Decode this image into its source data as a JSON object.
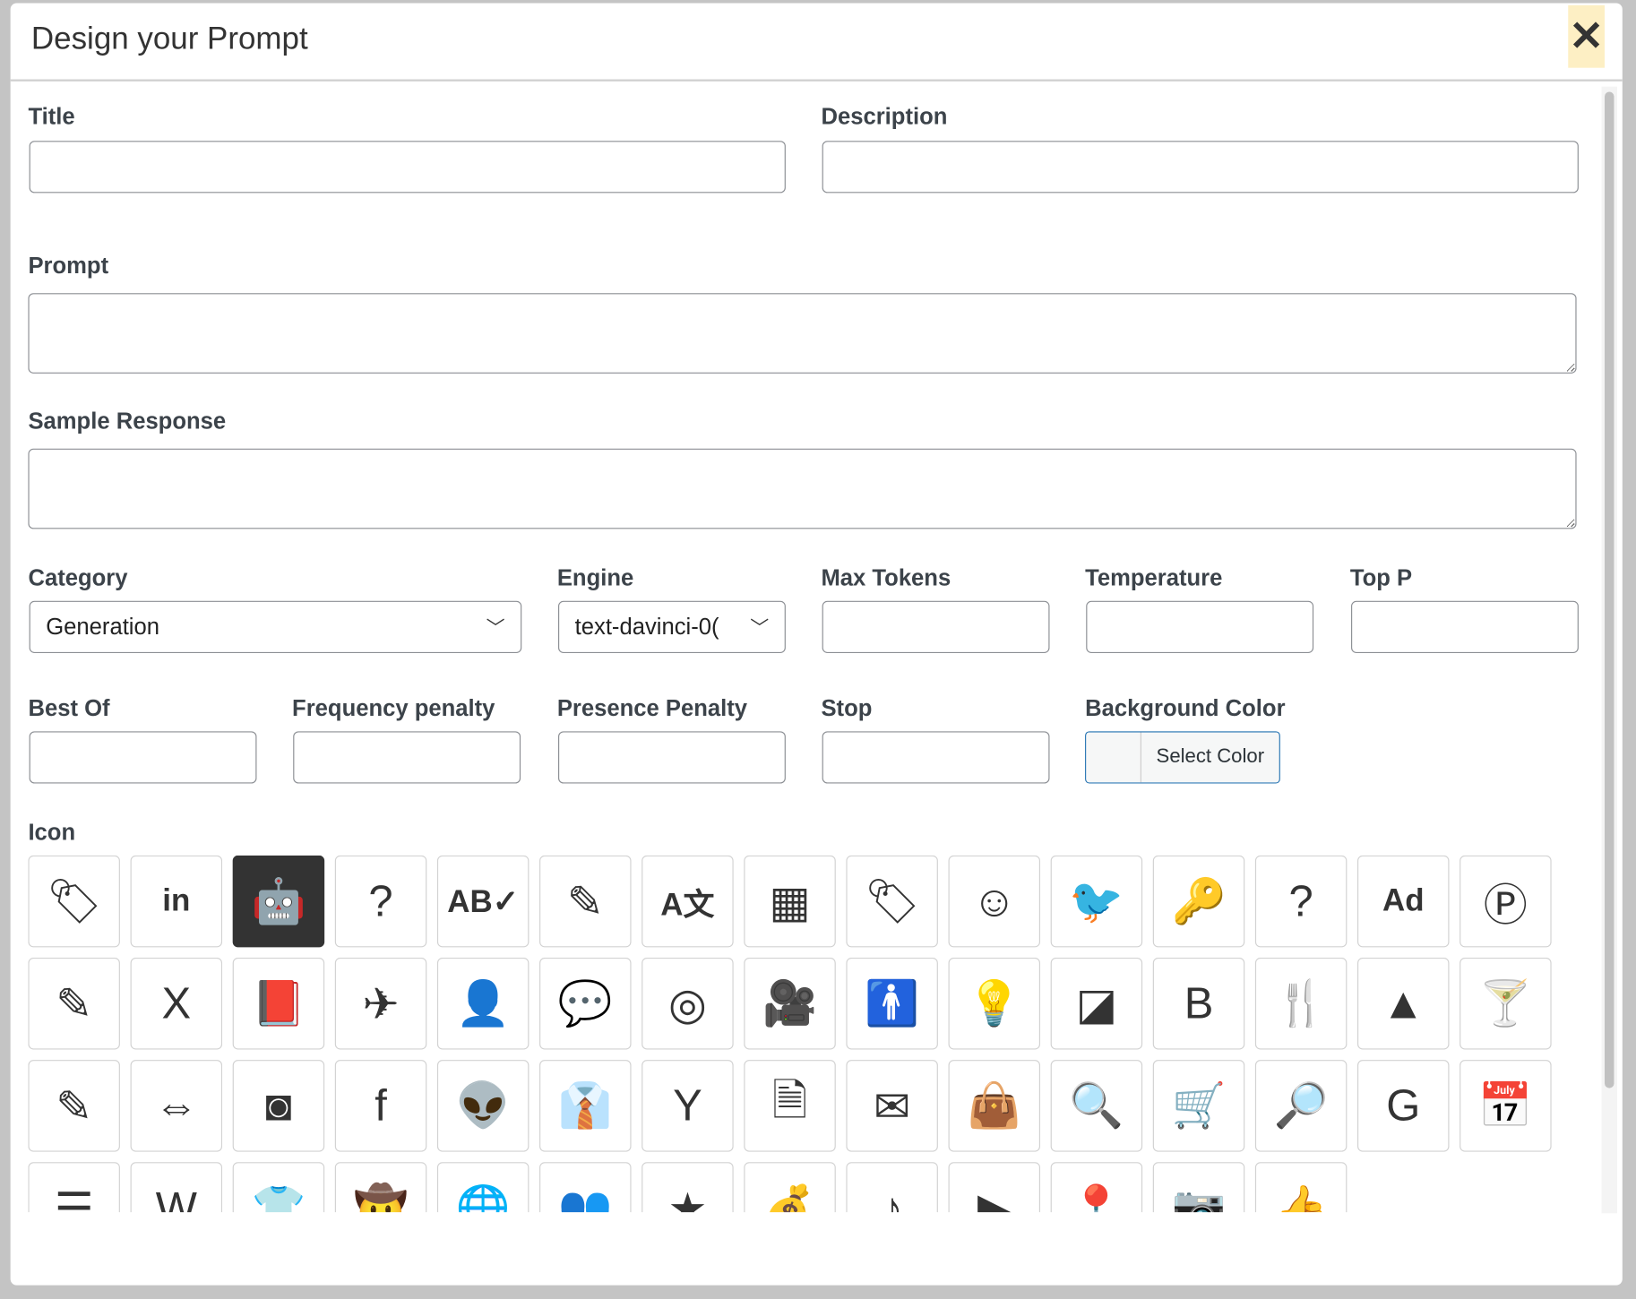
{
  "modal": {
    "title": "Design your Prompt",
    "close_label": "✕"
  },
  "fields": {
    "title": {
      "label": "Title",
      "value": ""
    },
    "description": {
      "label": "Description",
      "value": ""
    },
    "prompt": {
      "label": "Prompt",
      "value": ""
    },
    "sample_response": {
      "label": "Sample Response",
      "value": ""
    },
    "category": {
      "label": "Category",
      "value": "Generation"
    },
    "engine": {
      "label": "Engine",
      "value": "text-davinci-0("
    },
    "max_tokens": {
      "label": "Max Tokens",
      "value": ""
    },
    "temperature": {
      "label": "Temperature",
      "value": ""
    },
    "top_p": {
      "label": "Top P",
      "value": ""
    },
    "best_of": {
      "label": "Best Of",
      "value": ""
    },
    "frequency_penalty": {
      "label": "Frequency penalty",
      "value": ""
    },
    "presence_penalty": {
      "label": "Presence Penalty",
      "value": ""
    },
    "stop": {
      "label": "Stop",
      "value": ""
    },
    "background_color": {
      "label": "Background Color",
      "button_label": "Select Color"
    }
  },
  "icons": {
    "label": "Icon",
    "selected": "robot",
    "items": [
      {
        "name": "tag",
        "glyph": "🏷"
      },
      {
        "name": "linkedin",
        "glyph": "in"
      },
      {
        "name": "robot",
        "glyph": "🤖"
      },
      {
        "name": "question-circle",
        "glyph": "?"
      },
      {
        "name": "spell-check",
        "glyph": "AB✓"
      },
      {
        "name": "edit",
        "glyph": "✎"
      },
      {
        "name": "language",
        "glyph": "A文"
      },
      {
        "name": "table",
        "glyph": "▦"
      },
      {
        "name": "tag-2",
        "glyph": "🏷"
      },
      {
        "name": "smile",
        "glyph": "☺"
      },
      {
        "name": "twitter",
        "glyph": "🐦"
      },
      {
        "name": "key",
        "glyph": "🔑"
      },
      {
        "name": "clipboard-question",
        "glyph": "?"
      },
      {
        "name": "ad",
        "glyph": "Ad"
      },
      {
        "name": "parking",
        "glyph": "Ⓟ"
      },
      {
        "name": "pen-square",
        "glyph": "✎"
      },
      {
        "name": "file-excel",
        "glyph": "X"
      },
      {
        "name": "book",
        "glyph": "📕"
      },
      {
        "name": "plane",
        "glyph": "✈"
      },
      {
        "name": "address-book",
        "glyph": "👤"
      },
      {
        "name": "comment-dots",
        "glyph": "💬"
      },
      {
        "name": "bullseye",
        "glyph": "◎"
      },
      {
        "name": "video",
        "glyph": "🎥"
      },
      {
        "name": "child",
        "glyph": "🚹"
      },
      {
        "name": "lightbulb",
        "glyph": "💡"
      },
      {
        "name": "sticky-note",
        "glyph": "◪"
      },
      {
        "name": "blogger",
        "glyph": "B"
      },
      {
        "name": "utensils",
        "glyph": "🍴"
      },
      {
        "name": "road",
        "glyph": "▲"
      },
      {
        "name": "cocktail",
        "glyph": "🍸"
      },
      {
        "name": "edit-2",
        "glyph": "✎"
      },
      {
        "name": "people-arrows",
        "glyph": "⇔"
      },
      {
        "name": "instagram",
        "glyph": "◙"
      },
      {
        "name": "facebook",
        "glyph": "f"
      },
      {
        "name": "reddit",
        "glyph": "👽"
      },
      {
        "name": "user-tie",
        "glyph": "👔"
      },
      {
        "name": "yahoo",
        "glyph": "Y"
      },
      {
        "name": "file",
        "glyph": "🗎"
      },
      {
        "name": "envelope",
        "glyph": "✉"
      },
      {
        "name": "shopping-bag",
        "glyph": "👜"
      },
      {
        "name": "search-dollar",
        "glyph": "🔍"
      },
      {
        "name": "shopping-cart",
        "glyph": "🛒"
      },
      {
        "name": "search-bolt",
        "glyph": "🔎"
      },
      {
        "name": "google",
        "glyph": "G"
      },
      {
        "name": "calendar",
        "glyph": "📅"
      },
      {
        "name": "list",
        "glyph": "☰"
      },
      {
        "name": "wikipedia",
        "glyph": "W"
      },
      {
        "name": "tshirt",
        "glyph": "👕"
      },
      {
        "name": "hat-cowboy",
        "glyph": "🤠"
      },
      {
        "name": "globe",
        "glyph": "🌐"
      },
      {
        "name": "users",
        "glyph": "👥"
      },
      {
        "name": "star",
        "glyph": "★"
      },
      {
        "name": "money-bag",
        "glyph": "💰"
      },
      {
        "name": "tiktok",
        "glyph": "♪"
      },
      {
        "name": "youtube",
        "glyph": "▶"
      },
      {
        "name": "map-pin",
        "glyph": "📍"
      },
      {
        "name": "camera",
        "glyph": "📷"
      },
      {
        "name": "thumbs-up",
        "glyph": "👍"
      }
    ]
  }
}
